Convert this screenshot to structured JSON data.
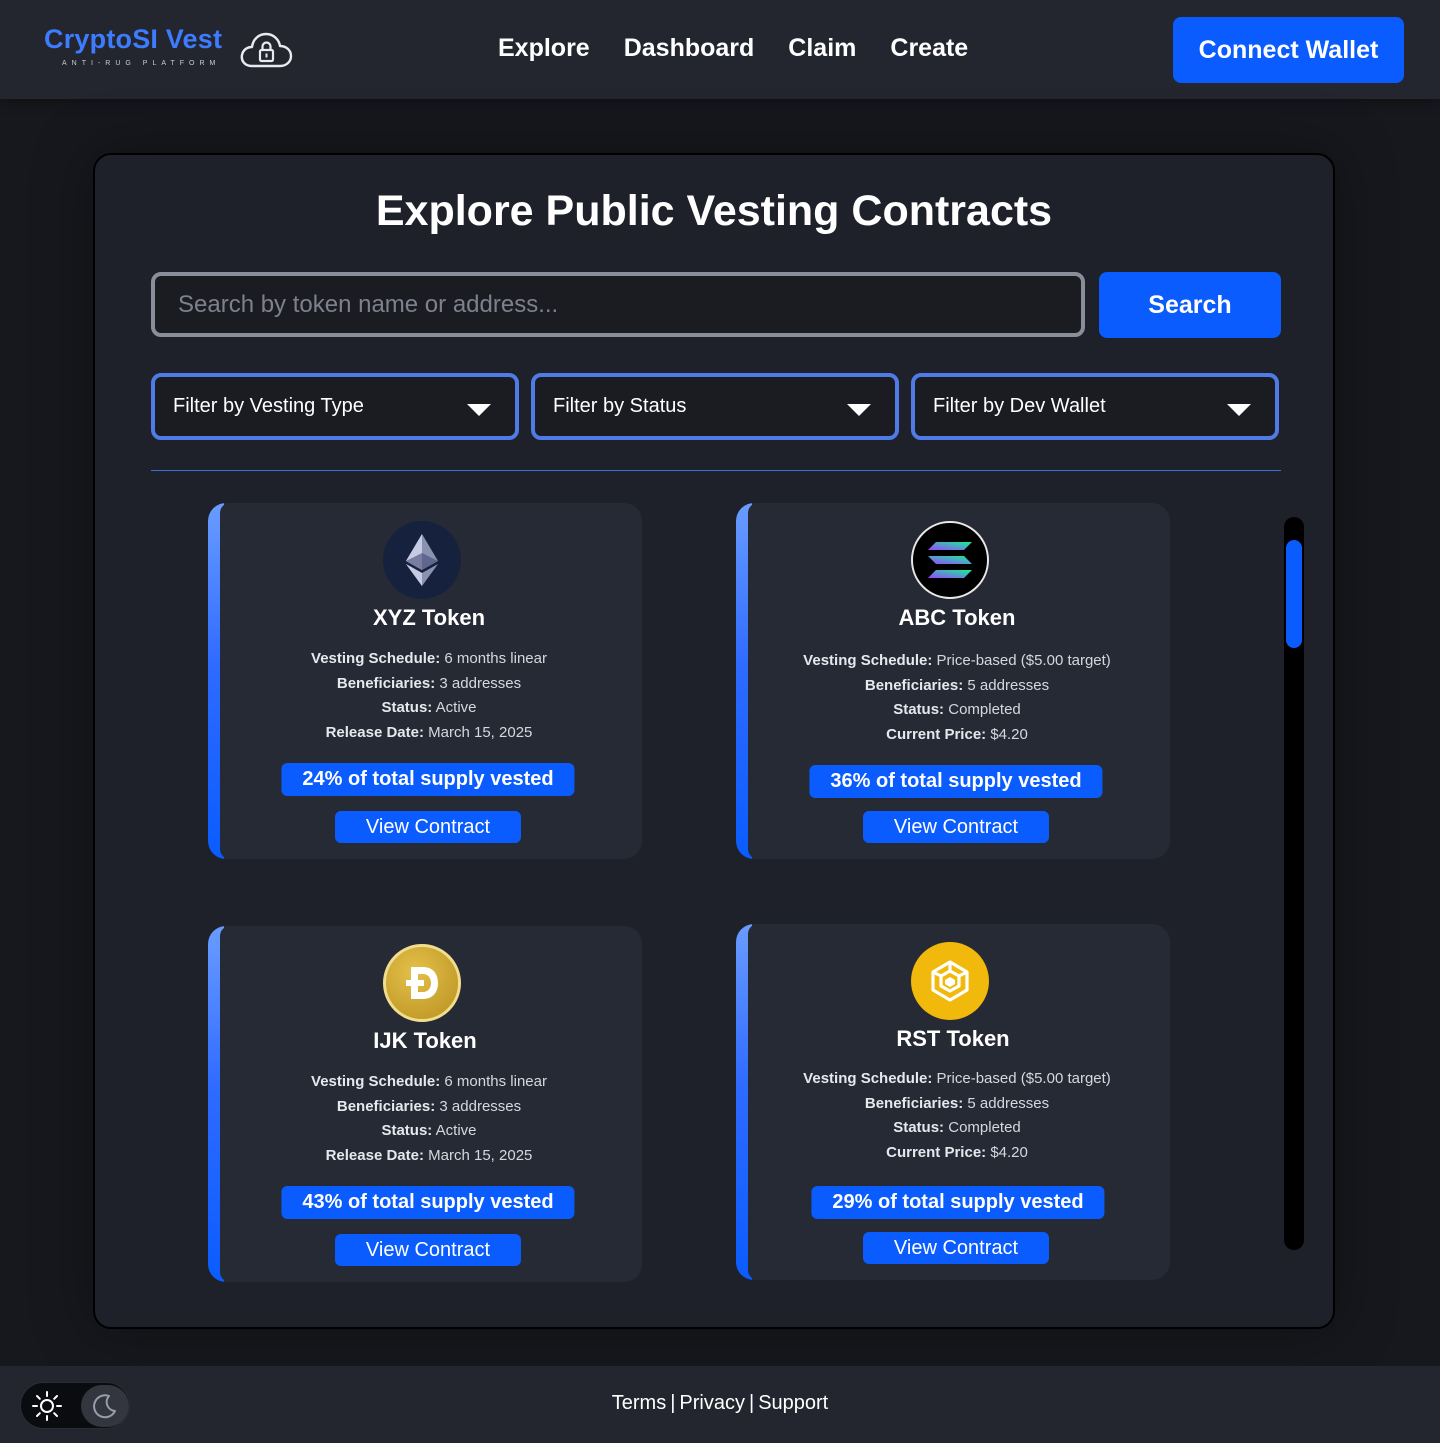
{
  "header": {
    "logo_title": "CryptoSI Vest",
    "logo_subtitle": "ANTI-RUG PLATFORM",
    "nav": [
      "Explore",
      "Dashboard",
      "Claim",
      "Create"
    ],
    "connect_label": "Connect Wallet"
  },
  "main": {
    "title": "Explore Public Vesting Contracts",
    "search_placeholder": "Search by token name or address...",
    "search_label": "Search",
    "filters": [
      "Filter by Vesting Type",
      "Filter by Status",
      "Filter by Dev Wallet"
    ]
  },
  "labels": {
    "vesting_schedule": "Vesting Schedule:",
    "beneficiaries": "Beneficiaries:",
    "status": "Status:",
    "release_date": "Release Date:",
    "current_price": "Current Price:",
    "view_contract": "View Contract"
  },
  "cards": [
    {
      "name": "XYZ Token",
      "icon": "ethereum-icon",
      "vesting_schedule": "6 months linear",
      "beneficiaries": "3 addresses",
      "status": "Active",
      "extra_label": "Release Date:",
      "extra_value": "March 15, 2025",
      "supply": "24% of total supply vested",
      "supply_percent": 24
    },
    {
      "name": "ABC Token",
      "icon": "solana-icon",
      "vesting_schedule": "Price-based ($5.00 target)",
      "beneficiaries": "5 addresses",
      "status": "Completed",
      "extra_label": "Current Price:",
      "extra_value": "$4.20",
      "supply": "36% of total supply vested",
      "supply_percent": 36
    },
    {
      "name": "IJK Token",
      "icon": "dogecoin-icon",
      "vesting_schedule": "6 months linear",
      "beneficiaries": "3 addresses",
      "status": "Active",
      "extra_label": "Release Date:",
      "extra_value": "March 15, 2025",
      "supply": "43% of total supply vested",
      "supply_percent": 43
    },
    {
      "name": "RST Token",
      "icon": "bnb-icon",
      "vesting_schedule": "Price-based ($5.00 target)",
      "beneficiaries": "5 addresses",
      "status": "Completed",
      "extra_label": "Current Price:",
      "extra_value": "$4.20",
      "supply": "29% of total supply vested",
      "supply_percent": 29
    }
  ],
  "footer": {
    "links": [
      "Terms",
      "Privacy",
      "Support"
    ],
    "separator": "|"
  },
  "colors": {
    "accent": "#0a5cff",
    "logo": "#3d7bff",
    "background": "#16181d",
    "panel": "#1e2129",
    "card": "#262a34"
  }
}
